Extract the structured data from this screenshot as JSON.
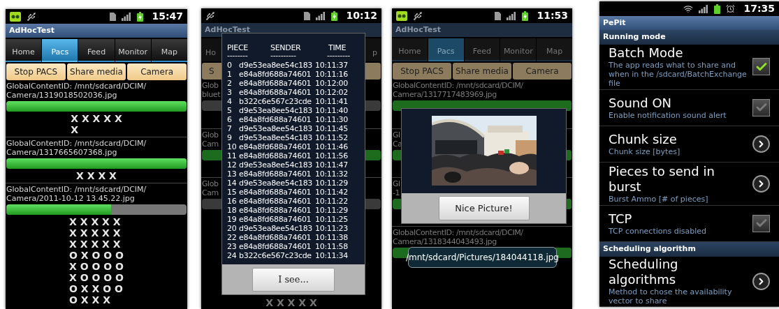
{
  "phones": [
    {
      "kind": "pacs",
      "dimmed": false,
      "status_bar": {
        "kind": "app",
        "time": "15:47"
      },
      "title": "AdHocTest",
      "tabs": [
        {
          "label": "Home",
          "selected": false
        },
        {
          "label": "Pacs",
          "selected": true
        },
        {
          "label": "Feed",
          "selected": false
        },
        {
          "label": "Monitor",
          "selected": false
        },
        {
          "label": "Map",
          "selected": false
        }
      ],
      "buttons": [
        "Stop PACS",
        "Share media",
        "Camera"
      ],
      "entries": [
        {
          "text": [
            "GlobalContentID: /mnt/sdcard/DCIM/",
            "Camera/1319018502036.jpg"
          ],
          "level": 1,
          "marks": [
            "X X X X X",
            "X"
          ]
        },
        {
          "text": [
            "GlobalContentID: /mnt/sdcard/DCIM/",
            "Camera/1317665607368.jpg"
          ],
          "level": 1,
          "marks": [
            "X X X X"
          ]
        },
        {
          "text": [
            "GlobalContentID: /mnt/sdcard/DCIM/",
            "Camera/2011-10-12 13.45.22.jpg"
          ],
          "level": 0.58,
          "marks": [
            "X X X X X",
            "X X X X X",
            "X X X X X",
            "O X O O O",
            "X O O O O",
            "X O O O O",
            "O X X O O",
            "O X X X"
          ]
        }
      ]
    },
    {
      "kind": "pacs",
      "dimmed": true,
      "status_bar": {
        "kind": "plain",
        "time": "10:12"
      },
      "title": "AdHocTest",
      "tab_fragments": [
        "Ho",
        "p"
      ],
      "button_fragments": [
        "S"
      ],
      "entries": [
        {
          "text": [
            "Glob",
            "bluet"
          ],
          "level": 0
        },
        {
          "text": [
            "Glob",
            "Cam"
          ],
          "level": 1
        },
        {
          "text": [
            "Glob",
            "Cam"
          ],
          "level": 0
        }
      ],
      "footer_marks": "X X X X X",
      "dialog": {
        "kind": "table",
        "columns": [
          "PIECE",
          "SENDER",
          "TIME"
        ],
        "rules": [
          "--------",
          "----------",
          "---------"
        ],
        "rows": [
          [
            "0",
            "d9e53ea8ee54c183",
            "10:11:37"
          ],
          [
            "1",
            "e84a8fd688a74601",
            "10:11:16"
          ],
          [
            "2",
            "e84a8fd688a74601",
            "10:12:00"
          ],
          [
            "3",
            "e84a8fd688a74601",
            "10:12:02"
          ],
          [
            "4",
            "b322c6e567c23cde",
            "10:11:41"
          ],
          [
            "5",
            "d9e53ea8ee54c183",
            "10:11:40"
          ],
          [
            "6",
            "e84a8fd688a74601",
            "10:11:30"
          ],
          [
            "7",
            "d9e53ea8ee54c183",
            "10:11:45"
          ],
          [
            "9",
            "d9e53ea8ee54c183",
            "10:11:52"
          ],
          [
            "10",
            "e84a8fd688a74601",
            "10:11:46"
          ],
          [
            "11",
            "e84a8fd688a74601",
            "10:11:56"
          ],
          [
            "12",
            "d9e53ea8ee54c183",
            "10:11:47"
          ],
          [
            "13",
            "e84a8fd688a74601",
            "10:11:32"
          ],
          [
            "14",
            "d9e53ea8ee54c183",
            "10:11:29"
          ],
          [
            "15",
            "e84a8fd688a74601",
            "10:11:42"
          ],
          [
            "16",
            "e84a8fd688a74601",
            "10:11:22"
          ],
          [
            "18",
            "e84a8fd688a74601",
            "10:11:29"
          ],
          [
            "19",
            "e84a8fd688a74601",
            "10:11:25"
          ],
          [
            "20",
            "d9e53ea8ee54c183",
            "10:11:23"
          ],
          [
            "22",
            "e84a8fd688a74601",
            "10:11:38"
          ],
          [
            "23",
            "e84a8fd688a74601",
            "10:11:58"
          ],
          [
            "24",
            "b322c6e567c23cde",
            "10:11:34"
          ]
        ],
        "button": "I see..."
      }
    },
    {
      "kind": "pacs",
      "dimmed": true,
      "status_bar": {
        "kind": "app",
        "time": "11:53"
      },
      "title": "AdHocTest",
      "tabs": [
        {
          "label": "Home",
          "selected": false
        },
        {
          "label": "Pacs",
          "selected": true
        },
        {
          "label": "Feed",
          "selected": false
        },
        {
          "label": "Monitor",
          "selected": false
        },
        {
          "label": "Map",
          "selected": false
        }
      ],
      "buttons": [
        "Stop PACS",
        "Share media",
        "Camera"
      ],
      "entries": [
        {
          "text": [
            "GlobalContentID: /mnt/sdcard/DCIM/",
            "Camera/1317717483969.jpg"
          ],
          "level": 1
        },
        {
          "text": [
            "Gl",
            "Ca"
          ],
          "level": 1
        },
        {
          "text": [
            "Gl",
            "-1"
          ],
          "level": 1
        },
        {
          "text": [
            "GlobalContentID: /mnt/sdcard/DCIM/",
            "Camera/1318344043493.jpg"
          ],
          "level": 1
        }
      ],
      "dialog": {
        "kind": "picture",
        "button": "Nice Picture!"
      },
      "toast": "/mnt/sdcard/Pictures/184044118.jpg"
    },
    {
      "kind": "settings",
      "status_bar": {
        "kind": "wifi",
        "time": "17:35"
      },
      "title": "PePit",
      "sections": [
        {
          "header": "Running mode",
          "items": [
            {
              "kind": "checkbox",
              "title": "Batch Mode",
              "summary": "The app reads what to share and when in the /sdcard/BatchExchange file",
              "checked": true
            },
            {
              "kind": "checkbox",
              "title": "Sound ON",
              "summary": "Enable notification sound alert",
              "checked": false
            },
            {
              "kind": "arrow",
              "title": "Chunk size",
              "summary": "Chunk size [bytes]"
            },
            {
              "kind": "arrow",
              "title": "Pieces to send in burst",
              "summary": "Burst Ammo [# of pieces]"
            },
            {
              "kind": "checkbox",
              "title": "TCP",
              "summary": "TCP connections disabled",
              "checked": false
            }
          ]
        },
        {
          "header": "Scheduling algorithm",
          "items": [
            {
              "kind": "arrow",
              "title": "Scheduling algorithms",
              "summary": "Method to chose the availability vector to share"
            }
          ]
        }
      ]
    }
  ]
}
